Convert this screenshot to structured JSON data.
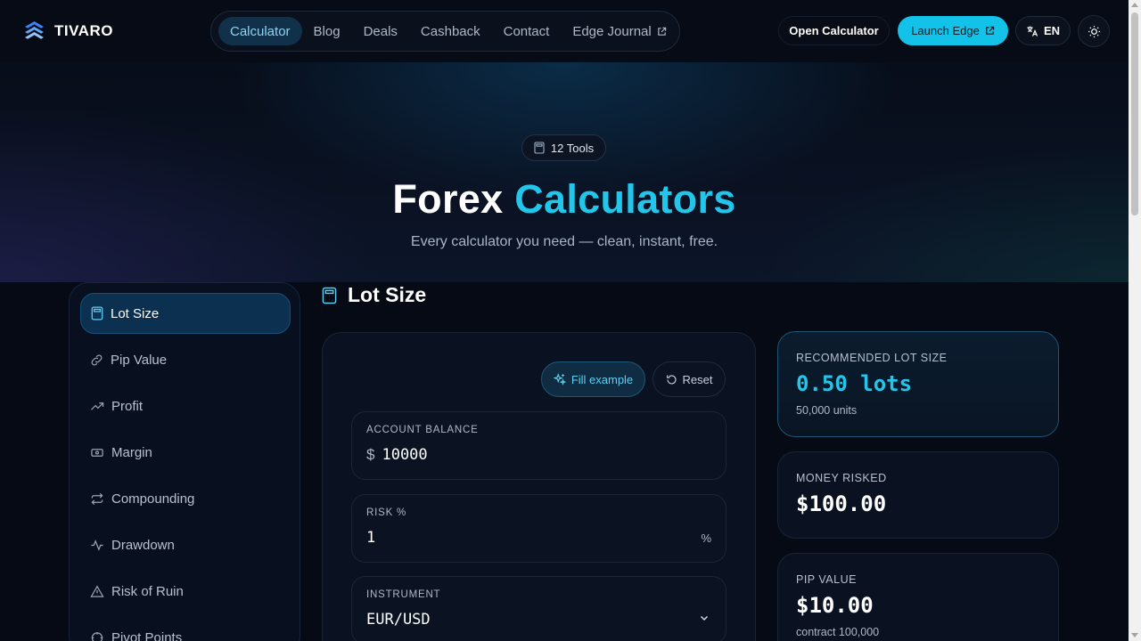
{
  "brand": {
    "name": "TIVARO",
    "accent_color": "#22c6ea"
  },
  "nav": {
    "items": [
      {
        "label": "Calculator",
        "active": true
      },
      {
        "label": "Blog"
      },
      {
        "label": "Deals"
      },
      {
        "label": "Cashback"
      },
      {
        "label": "Contact"
      },
      {
        "label": "Edge Journal",
        "icon": "external-link-icon"
      }
    ]
  },
  "header_actions": {
    "open_calculator": "Open Calculator",
    "launch_edge": "Launch Edge",
    "language": "EN",
    "theme_icon": "sun-icon"
  },
  "hero": {
    "badge": "12 Tools",
    "title_main": "Forex",
    "title_accent": "Calculators",
    "subtitle": "Every calculator you need — clean, instant, free."
  },
  "sidebar": {
    "items": [
      {
        "label": "Lot Size",
        "icon": "calculator-icon",
        "active": true
      },
      {
        "label": "Pip Value",
        "icon": "link-icon"
      },
      {
        "label": "Profit",
        "icon": "trending-up-icon"
      },
      {
        "label": "Margin",
        "icon": "banknote-icon"
      },
      {
        "label": "Compounding",
        "icon": "repeat-icon"
      },
      {
        "label": "Drawdown",
        "icon": "activity-icon"
      },
      {
        "label": "Risk of Ruin",
        "icon": "warning-icon"
      },
      {
        "label": "Pivot Points",
        "icon": "pivot-icon"
      }
    ]
  },
  "main": {
    "section_title": "Lot Size",
    "fill_example": "Fill example",
    "reset": "Reset",
    "fields": {
      "account_balance": {
        "label": "ACCOUNT BALANCE",
        "prefix": "$",
        "value": "10000"
      },
      "risk": {
        "label": "RISK %",
        "value": "1",
        "suffix": "%"
      },
      "instrument": {
        "label": "INSTRUMENT",
        "value": "EUR/USD"
      }
    }
  },
  "results": {
    "lot_size": {
      "label": "RECOMMENDED LOT SIZE",
      "value": "0.50 lots",
      "sub": "50,000 units"
    },
    "money_risked": {
      "label": "MONEY RISKED",
      "value": "$100.00"
    },
    "pip_value": {
      "label": "PIP VALUE",
      "value": "$10.00",
      "sub": "contract 100,000"
    }
  }
}
